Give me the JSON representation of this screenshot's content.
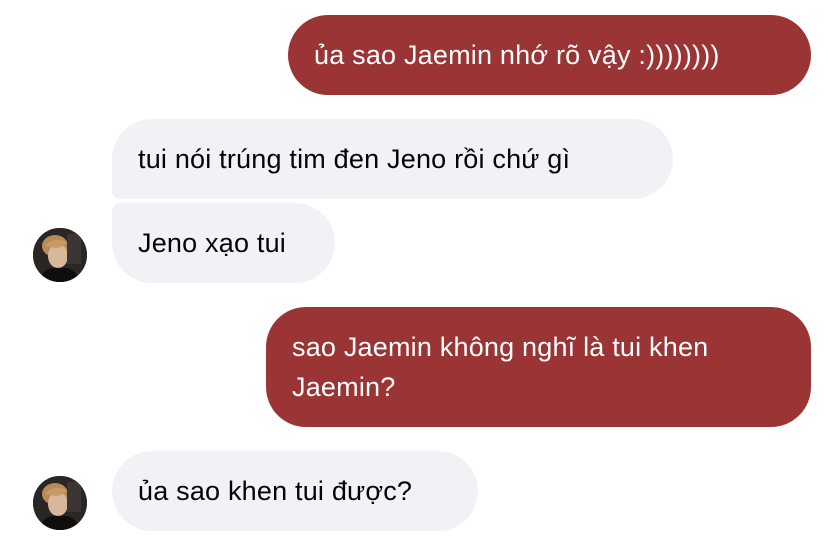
{
  "colors": {
    "sent_bubble": "#9b3434",
    "received_bubble": "#f1f2f5",
    "sent_text": "#ffffff",
    "received_text": "#050505",
    "background": "#ffffff"
  },
  "messages": [
    {
      "from": "me",
      "text": "ủa sao Jaemin nhớ rõ vậy :))))))))"
    },
    {
      "from": "other",
      "text": "tui nói trúng tim đen Jeno rồi chứ gì"
    },
    {
      "from": "other",
      "text": "Jeno xạo tui"
    },
    {
      "from": "me",
      "lines": [
        "sao Jaemin không nghĩ là tui khen",
        "Jaemin?"
      ]
    },
    {
      "from": "other",
      "text": "ủa sao khen tui được?"
    }
  ],
  "avatar_icon": "contact-avatar-photo"
}
